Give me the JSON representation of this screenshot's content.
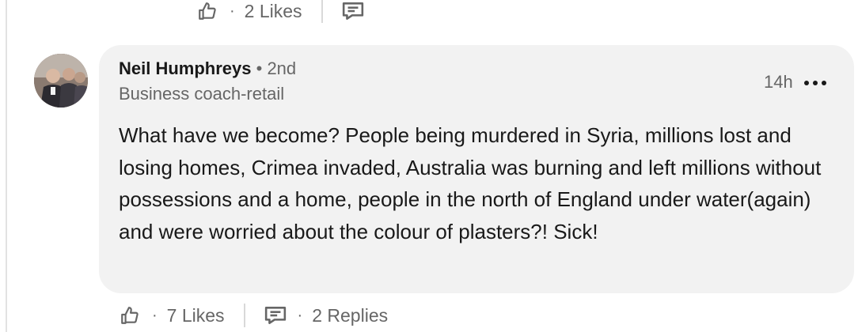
{
  "previous_comment": {
    "likes_label": "2 Likes"
  },
  "comment": {
    "author_name": "Neil Humphreys",
    "connection_degree": "• 2nd",
    "headline": "Business coach-retail",
    "timestamp": "14h",
    "text": "What have we become? People being murdered in Syria, millions lost and losing homes, Crimea invaded, Australia was burning and left millions without possessions and a home, people in the north of England under water(again) and were worried about the colour of plasters?! Sick!",
    "likes_label": "7 Likes",
    "replies_label": "2 Replies"
  },
  "ui": {
    "separator_dot": "·"
  },
  "icons": {
    "like": "thumbs-up-icon",
    "reply": "comment-bubble-icon",
    "more": "more-horizontal-icon"
  }
}
